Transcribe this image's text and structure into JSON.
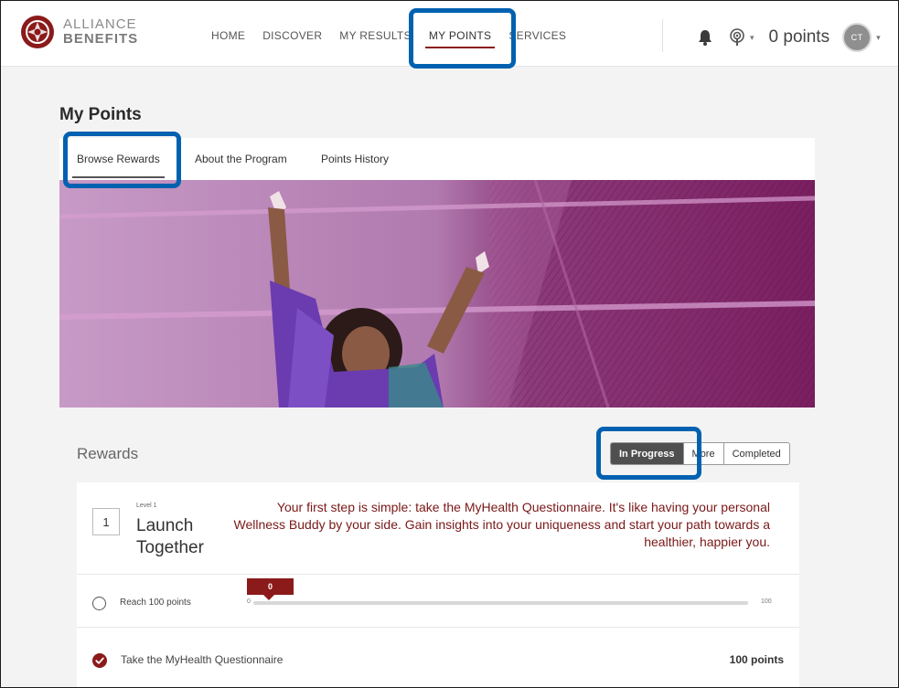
{
  "brand": {
    "line1": "ALLIANCE",
    "line2": "BENEFITS",
    "accent": "#8b1a1a"
  },
  "nav": {
    "links": [
      {
        "label": "HOME"
      },
      {
        "label": "DISCOVER"
      },
      {
        "label": "MY RESULTS"
      },
      {
        "label": "MY POINTS",
        "active": true
      },
      {
        "label": "SERVICES"
      }
    ],
    "icons": {
      "notifications": "bell-icon",
      "podcast": "podcast-icon"
    },
    "points_total": "0 points",
    "avatar_initials": "CT"
  },
  "page": {
    "title": "My Points",
    "tabs": [
      {
        "label": "Browse Rewards",
        "active": true
      },
      {
        "label": "About the Program"
      },
      {
        "label": "Points History"
      }
    ]
  },
  "rewards": {
    "title": "Rewards",
    "filters": [
      {
        "label": "In Progress",
        "active": true
      },
      {
        "label": "More"
      },
      {
        "label": "Completed"
      }
    ],
    "level": {
      "number": "1",
      "label": "Level 1",
      "name": "Launch Together",
      "description": "Your first step is simple: take the MyHealth Questionnaire. It's like having your personal Wellness Buddy by your side. Gain insights into your uniqueness and start your path towards a healthier, happier you."
    },
    "progress": {
      "label": "Reach 100 points",
      "current": "0",
      "min": "0",
      "max": "100",
      "fraction": 0
    },
    "task": {
      "label": "Take the MyHealth Questionnaire",
      "points": "100 points",
      "status": "completed"
    }
  },
  "highlight_color": "#0061b0"
}
